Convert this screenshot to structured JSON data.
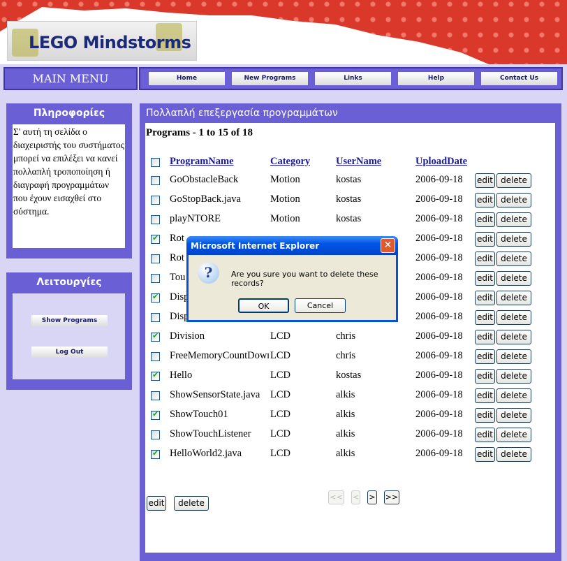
{
  "header": {
    "logo_text": "LEGO Mindstorms"
  },
  "nav": {
    "main_menu": "MAIN MENU",
    "items": [
      "Home",
      "New Programs",
      "Links",
      "Help",
      "Contact Us"
    ]
  },
  "sidebar": {
    "info_title": "Πληροφορίες",
    "info_text": "Σ' αυτή τη σελίδα ο διαχειριστής του συστήματος μπορεί να επιλέξει να κανεί πολλαπλή τροποποίηση ή διαγραφή προγραμμάτων που έχουν εισαχθεί στο σύστημα.",
    "ops_title": "Λειτουργίες",
    "show_programs": "Show Programs",
    "log_out": "Log Out"
  },
  "main": {
    "title": "Πολλαπλή επεξεργασία προγραμμάτων",
    "count": "Programs - 1 to 15 of 18",
    "columns": [
      "ProgramName",
      "Category",
      "UserName",
      "UploadDate"
    ],
    "edit_label": "edit",
    "delete_label": "delete",
    "rows": [
      {
        "checked": false,
        "name": "GoObstacleBack",
        "category": "Motion",
        "user": "kostas",
        "date": "2006-09-18"
      },
      {
        "checked": false,
        "name": "GoStopBack.java",
        "category": "Motion",
        "user": "kostas",
        "date": "2006-09-18"
      },
      {
        "checked": false,
        "name": "playNTORE",
        "category": "Motion",
        "user": "kostas",
        "date": "2006-09-18"
      },
      {
        "checked": true,
        "name": "Rot",
        "category": "",
        "user": "",
        "date": "2006-09-18"
      },
      {
        "checked": false,
        "name": "Rot",
        "category": "",
        "user": "",
        "date": "2006-09-18"
      },
      {
        "checked": false,
        "name": "Tou",
        "category": "",
        "user": "",
        "date": "2006-09-18"
      },
      {
        "checked": true,
        "name": "Disp",
        "category": "",
        "user": "",
        "date": "2006-09-18"
      },
      {
        "checked": false,
        "name": "Disp",
        "category": "",
        "user": "",
        "date": "2006-09-18"
      },
      {
        "checked": true,
        "name": "Division",
        "category": "LCD",
        "user": "chris",
        "date": "2006-09-18"
      },
      {
        "checked": false,
        "name": "FreeMemoryCountDown",
        "category": "LCD",
        "user": "chris",
        "date": "2006-09-18"
      },
      {
        "checked": true,
        "name": "Hello",
        "category": "LCD",
        "user": "kostas",
        "date": "2006-09-18"
      },
      {
        "checked": false,
        "name": "ShowSensorState.java",
        "category": "LCD",
        "user": "alkis",
        "date": "2006-09-18"
      },
      {
        "checked": true,
        "name": "ShowTouch01",
        "category": "LCD",
        "user": "alkis",
        "date": "2006-09-18"
      },
      {
        "checked": false,
        "name": "ShowTouchListener",
        "category": "LCD",
        "user": "alkis",
        "date": "2006-09-18"
      },
      {
        "checked": true,
        "name": "HelloWorld2.java",
        "category": "LCD",
        "user": "alkis",
        "date": "2006-09-18"
      }
    ],
    "pager": {
      "first": "<<",
      "prev": "<",
      "next": ">",
      "last": ">>"
    },
    "bulk_edit": "edit",
    "bulk_delete": "delete"
  },
  "dialog": {
    "title": "Microsoft Internet Explorer",
    "message": "Are you sure you want to delete these records?",
    "ok": "OK",
    "cancel": "Cancel",
    "icon": "question-icon"
  }
}
